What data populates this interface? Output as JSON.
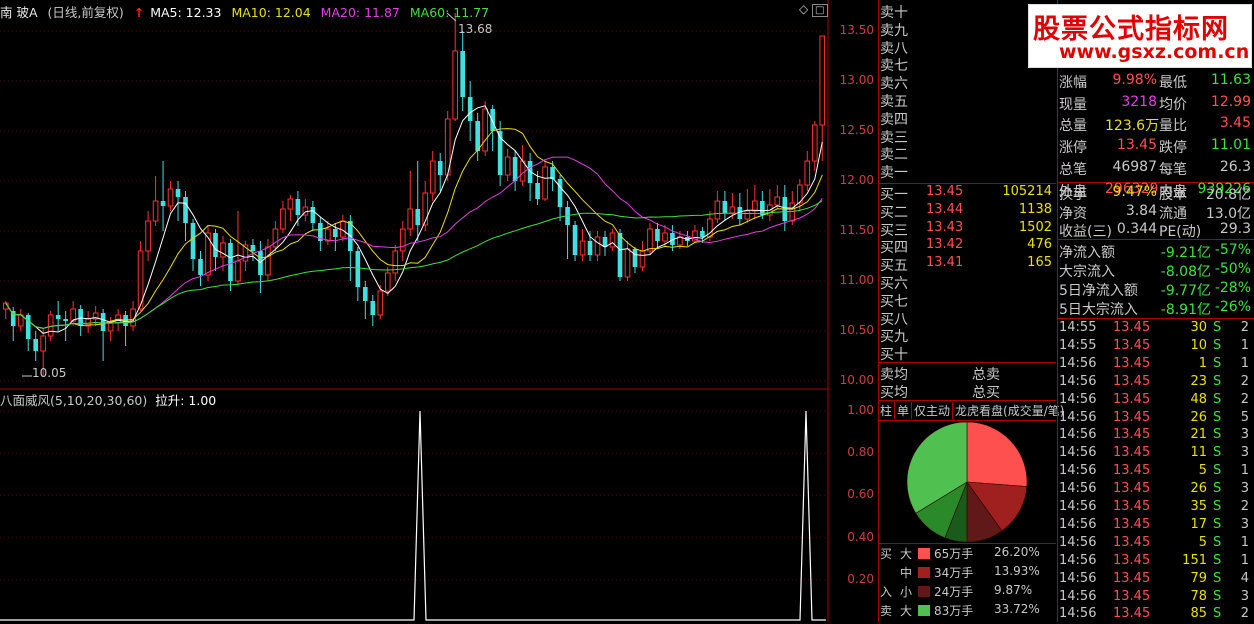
{
  "header": {
    "stock_name": "南 玻A",
    "period": "(日线,前复权)",
    "ma5": "MA5: 12.33",
    "ma10": "MA10: 12.04",
    "ma20": "MA20: 11.87",
    "ma60": "MA60: 11.77"
  },
  "colors": {
    "ma5": "#ffffff",
    "ma10": "#e8e000",
    "ma20": "#e040e0",
    "ma60": "#40e040",
    "up": "#ff3030",
    "down": "#40e0e0"
  },
  "main_axis": [
    "13.50",
    "13.00",
    "12.50",
    "12.00",
    "11.50",
    "11.00",
    "10.50",
    "10.00"
  ],
  "high_label": "13.68",
  "low_label": "10.05",
  "indicator": {
    "title": "八面威风(5,10,20,30,60)",
    "value": "拉升: 1.00",
    "axis": [
      "1.00",
      "0.80",
      "0.60",
      "0.40",
      "0.20"
    ]
  },
  "chart_data": {
    "type": "candlestick",
    "ylim": [
      9.95,
      13.75
    ],
    "candles": [
      [
        10.72,
        10.78,
        10.62,
        10.8
      ],
      [
        10.7,
        10.55,
        10.4,
        10.74
      ],
      [
        10.55,
        10.66,
        10.5,
        10.72
      ],
      [
        10.66,
        10.42,
        10.3,
        10.68
      ],
      [
        10.42,
        10.3,
        10.2,
        10.5
      ],
      [
        10.3,
        10.45,
        10.05,
        10.52
      ],
      [
        10.45,
        10.66,
        10.4,
        10.7
      ],
      [
        10.66,
        10.62,
        10.5,
        10.8
      ],
      [
        10.62,
        10.6,
        10.4,
        10.7
      ],
      [
        10.6,
        10.72,
        10.55,
        10.8
      ],
      [
        10.72,
        10.55,
        10.45,
        10.76
      ],
      [
        10.55,
        10.62,
        10.48,
        10.7
      ],
      [
        10.62,
        10.68,
        10.55,
        10.75
      ],
      [
        10.68,
        10.5,
        10.2,
        10.72
      ],
      [
        10.5,
        10.58,
        10.4,
        10.64
      ],
      [
        10.58,
        10.66,
        10.5,
        10.72
      ],
      [
        10.66,
        10.55,
        10.35,
        10.7
      ],
      [
        10.55,
        10.72,
        10.5,
        10.8
      ],
      [
        10.72,
        11.3,
        10.7,
        11.4
      ],
      [
        11.3,
        11.6,
        11.2,
        11.7
      ],
      [
        11.6,
        11.8,
        11.55,
        12.05
      ],
      [
        11.8,
        11.75,
        11.5,
        12.2
      ],
      [
        11.75,
        11.92,
        11.7,
        12.0
      ],
      [
        11.92,
        11.84,
        11.6,
        12.0
      ],
      [
        11.84,
        11.58,
        11.4,
        11.9
      ],
      [
        11.58,
        11.22,
        11.1,
        11.62
      ],
      [
        11.22,
        11.06,
        10.95,
        11.3
      ],
      [
        11.06,
        11.48,
        11.0,
        11.55
      ],
      [
        11.48,
        11.24,
        11.1,
        11.52
      ],
      [
        11.24,
        11.38,
        11.1,
        11.45
      ],
      [
        11.38,
        11.0,
        10.9,
        11.42
      ],
      [
        11.0,
        11.2,
        10.95,
        11.7
      ],
      [
        11.2,
        11.36,
        11.1,
        11.4
      ],
      [
        11.36,
        11.3,
        11.2,
        11.42
      ],
      [
        11.3,
        11.06,
        10.88,
        11.4
      ],
      [
        11.06,
        11.34,
        11.0,
        11.42
      ],
      [
        11.34,
        11.52,
        11.3,
        11.6
      ],
      [
        11.52,
        11.72,
        11.48,
        11.8
      ],
      [
        11.72,
        11.82,
        11.6,
        11.86
      ],
      [
        11.82,
        11.66,
        11.55,
        11.9
      ],
      [
        11.66,
        11.74,
        11.6,
        11.82
      ],
      [
        11.74,
        11.58,
        11.5,
        11.8
      ],
      [
        11.58,
        11.4,
        11.3,
        11.64
      ],
      [
        11.4,
        11.52,
        11.36,
        11.6
      ],
      [
        11.52,
        11.44,
        11.3,
        11.58
      ],
      [
        11.44,
        11.6,
        11.4,
        11.66
      ],
      [
        11.6,
        11.3,
        11.0,
        11.66
      ],
      [
        11.3,
        10.94,
        10.8,
        11.34
      ],
      [
        10.94,
        10.8,
        10.62,
        11.0
      ],
      [
        10.8,
        10.66,
        10.55,
        10.86
      ],
      [
        10.66,
        10.9,
        10.62,
        10.96
      ],
      [
        10.9,
        11.08,
        10.85,
        11.14
      ],
      [
        11.08,
        11.3,
        11.0,
        11.36
      ],
      [
        11.3,
        11.52,
        11.2,
        11.6
      ],
      [
        11.52,
        11.72,
        11.45,
        12.1
      ],
      [
        11.72,
        11.56,
        11.4,
        12.2
      ],
      [
        11.56,
        11.88,
        11.5,
        12.0
      ],
      [
        11.88,
        12.2,
        11.8,
        12.3
      ],
      [
        12.2,
        12.06,
        11.9,
        12.28
      ],
      [
        12.06,
        12.62,
        12.0,
        12.7
      ],
      [
        12.62,
        13.3,
        12.6,
        13.68
      ],
      [
        13.3,
        12.84,
        12.7,
        13.5
      ],
      [
        12.84,
        12.6,
        12.4,
        13.0
      ],
      [
        12.6,
        12.3,
        12.2,
        12.68
      ],
      [
        12.3,
        12.72,
        12.25,
        12.8
      ],
      [
        12.72,
        12.5,
        12.3,
        12.76
      ],
      [
        12.5,
        12.06,
        11.95,
        12.6
      ],
      [
        12.06,
        12.24,
        12.0,
        12.32
      ],
      [
        12.24,
        12.0,
        11.9,
        12.3
      ],
      [
        12.0,
        12.2,
        11.95,
        12.36
      ],
      [
        12.2,
        11.98,
        11.8,
        12.28
      ],
      [
        11.98,
        11.82,
        11.76,
        12.1
      ],
      [
        11.82,
        12.14,
        11.8,
        12.22
      ],
      [
        12.14,
        12.02,
        11.9,
        12.2
      ],
      [
        12.02,
        11.74,
        11.6,
        12.06
      ],
      [
        11.74,
        11.56,
        11.22,
        11.8
      ],
      [
        11.56,
        11.26,
        11.2,
        11.6
      ],
      [
        11.26,
        11.4,
        11.2,
        11.52
      ],
      [
        11.4,
        11.26,
        11.2,
        11.5
      ],
      [
        11.26,
        11.44,
        11.2,
        11.5
      ],
      [
        11.44,
        11.34,
        11.25,
        11.5
      ],
      [
        11.34,
        11.48,
        11.3,
        11.52
      ],
      [
        11.48,
        11.04,
        11.0,
        11.52
      ],
      [
        11.04,
        11.32,
        11.0,
        11.4
      ],
      [
        11.32,
        11.14,
        11.08,
        11.34
      ],
      [
        11.14,
        11.3,
        11.1,
        11.4
      ],
      [
        11.3,
        11.52,
        11.26,
        11.58
      ],
      [
        11.52,
        11.4,
        11.34,
        11.58
      ],
      [
        11.4,
        11.48,
        11.34,
        11.56
      ],
      [
        11.48,
        11.36,
        11.3,
        11.56
      ],
      [
        11.36,
        11.44,
        11.32,
        11.5
      ],
      [
        11.44,
        11.4,
        11.35,
        11.5
      ],
      [
        11.4,
        11.5,
        11.38,
        11.56
      ],
      [
        11.5,
        11.44,
        11.38,
        11.54
      ],
      [
        11.44,
        11.62,
        11.4,
        11.7
      ],
      [
        11.62,
        11.8,
        11.58,
        11.9
      ],
      [
        11.8,
        11.68,
        11.6,
        11.9
      ],
      [
        11.68,
        11.74,
        11.62,
        11.88
      ],
      [
        11.74,
        11.62,
        11.56,
        11.88
      ],
      [
        11.62,
        11.7,
        11.58,
        11.92
      ],
      [
        11.7,
        11.8,
        11.62,
        11.96
      ],
      [
        11.8,
        11.66,
        11.62,
        11.9
      ],
      [
        11.66,
        11.76,
        11.6,
        11.92
      ],
      [
        11.76,
        11.84,
        11.72,
        11.96
      ],
      [
        11.84,
        11.6,
        11.5,
        11.96
      ],
      [
        11.6,
        11.78,
        11.56,
        11.9
      ],
      [
        11.78,
        11.96,
        11.7,
        12.02
      ],
      [
        11.96,
        12.2,
        11.9,
        12.3
      ],
      [
        12.2,
        12.56,
        12.1,
        12.6
      ],
      [
        12.56,
        13.45,
        12.2,
        13.45
      ]
    ]
  },
  "book": {
    "sell_labels": [
      "卖十",
      "卖九",
      "卖八",
      "卖七",
      "卖六",
      "卖五",
      "卖四",
      "卖三",
      "卖二",
      "卖一"
    ],
    "buy": [
      {
        "label": "买一",
        "price": "13.45",
        "vol": "105214"
      },
      {
        "label": "买二",
        "price": "13.44",
        "vol": "1138"
      },
      {
        "label": "买三",
        "price": "13.43",
        "vol": "1502"
      },
      {
        "label": "买四",
        "price": "13.42",
        "vol": "476"
      },
      {
        "label": "买五",
        "price": "13.41",
        "vol": "165"
      },
      {
        "label": "买六",
        "price": "",
        "vol": ""
      },
      {
        "label": "买七",
        "price": "",
        "vol": ""
      },
      {
        "label": "买八",
        "price": "",
        "vol": ""
      },
      {
        "label": "买九",
        "price": "",
        "vol": ""
      },
      {
        "label": "买十",
        "price": "",
        "vol": ""
      }
    ],
    "sell_avg": "卖均",
    "buy_avg": "买均",
    "total_sell": "总卖",
    "total_buy": "总买",
    "tabs": [
      "柱",
      "单",
      "仅主动",
      "龙虎看盘(成交量/笔)"
    ],
    "pie": [
      {
        "name": "大买",
        "pct": 26.2,
        "color": "#ff5050"
      },
      {
        "name": "中买",
        "pct": 13.93,
        "color": "#a02020"
      },
      {
        "name": "小买",
        "pct": 9.87,
        "color": "#601818"
      },
      {
        "name": "小卖",
        "pct": 6.0,
        "color": "#1a5a1a"
      },
      {
        "name": "中卖",
        "pct": 10.28,
        "color": "#2a8a2a"
      },
      {
        "name": "大卖",
        "pct": 33.72,
        "color": "#50c050"
      }
    ],
    "legend": [
      {
        "side": "买",
        "size": "大",
        "vol": "65万手",
        "pct": "26.20%",
        "color": "#ff5050"
      },
      {
        "side": "",
        "size": "中",
        "vol": "34万手",
        "pct": "13.93%",
        "color": "#a02020"
      },
      {
        "side": "入",
        "size": "小",
        "vol": "24万手",
        "pct": "9.87%",
        "color": "#601818"
      },
      {
        "side": "卖",
        "size": "大",
        "vol": "83万手",
        "pct": "33.72%",
        "color": "#50c050"
      }
    ]
  },
  "watermark": {
    "line1": "股票公式指标网",
    "line2": "www.gsxz.com.cn"
  },
  "quote": {
    "rows": [
      {
        "k1": "涨跌",
        "v1": "",
        "c1": "#ff5050",
        "k2": "最高",
        "v2": "",
        "c2": "#ff5050"
      },
      {
        "k1": "涨幅",
        "v1": "9.98%",
        "c1": "#ff5050",
        "k2": "最低",
        "v2": "11.63",
        "c2": "#40e040"
      },
      {
        "k1": "现量",
        "v1": "3218",
        "c1": "#e040e0",
        "k2": "均价",
        "v2": "12.99",
        "c2": "#ff5050"
      },
      {
        "k1": "总量",
        "v1": "123.6万",
        "c1": "#e8e000",
        "k2": "量比",
        "v2": "3.45",
        "c2": "#ff5050"
      },
      {
        "k1": "涨停",
        "v1": "13.45",
        "c1": "#ff5050",
        "k2": "跌停",
        "v2": "11.01",
        "c2": "#40e040"
      },
      {
        "k1": "总笔",
        "v1": "46987",
        "c1": "#c8c8c8",
        "k2": "每笔",
        "v2": "26.3",
        "c2": "#c8c8c8"
      },
      {
        "k1": "外盘",
        "v1": "296329",
        "c1": "#ff5050",
        "k2": "内盘",
        "v2": "939226",
        "c2": "#40e040"
      }
    ],
    "rows2": [
      {
        "k1": "换手",
        "v1": "9.47%",
        "c1": "#e8e000",
        "k2": "股本",
        "v2": "20.8亿",
        "c2": "#c8c8c8"
      },
      {
        "k1": "净资",
        "v1": "3.84",
        "c1": "#c8c8c8",
        "k2": "流通",
        "v2": "13.0亿",
        "c2": "#c8c8c8"
      },
      {
        "k1": "收益(三)",
        "v1": "0.344",
        "c1": "#c8c8c8",
        "k2": "PE(动)",
        "v2": "29.3",
        "c2": "#c8c8c8"
      }
    ],
    "flows": [
      {
        "k": "净流入额",
        "v": "-9.21亿",
        "p": "-57%"
      },
      {
        "k": "大宗流入",
        "v": "-8.08亿",
        "p": "-50%"
      },
      {
        "k": "5日净流入额",
        "v": "-9.77亿",
        "p": "-28%"
      },
      {
        "k": "5日大宗流入",
        "v": "-8.91亿",
        "p": "-26%"
      }
    ],
    "ticks": [
      {
        "t": "14:55",
        "p": "13.45",
        "v": "30",
        "s": "S",
        "n": "2"
      },
      {
        "t": "14:55",
        "p": "13.45",
        "v": "10",
        "s": "S",
        "n": "1"
      },
      {
        "t": "14:56",
        "p": "13.45",
        "v": "1",
        "s": "S",
        "n": "1"
      },
      {
        "t": "14:56",
        "p": "13.45",
        "v": "23",
        "s": "S",
        "n": "2"
      },
      {
        "t": "14:56",
        "p": "13.45",
        "v": "48",
        "s": "S",
        "n": "2"
      },
      {
        "t": "14:56",
        "p": "13.45",
        "v": "26",
        "s": "S",
        "n": "5"
      },
      {
        "t": "14:56",
        "p": "13.45",
        "v": "21",
        "s": "S",
        "n": "3"
      },
      {
        "t": "14:56",
        "p": "13.45",
        "v": "11",
        "s": "S",
        "n": "3"
      },
      {
        "t": "14:56",
        "p": "13.45",
        "v": "5",
        "s": "S",
        "n": "1"
      },
      {
        "t": "14:56",
        "p": "13.45",
        "v": "26",
        "s": "S",
        "n": "3"
      },
      {
        "t": "14:56",
        "p": "13.45",
        "v": "35",
        "s": "S",
        "n": "2"
      },
      {
        "t": "14:56",
        "p": "13.45",
        "v": "17",
        "s": "S",
        "n": "3"
      },
      {
        "t": "14:56",
        "p": "13.45",
        "v": "5",
        "s": "S",
        "n": "1"
      },
      {
        "t": "14:56",
        "p": "13.45",
        "v": "151",
        "s": "S",
        "n": "1"
      },
      {
        "t": "14:56",
        "p": "13.45",
        "v": "79",
        "s": "S",
        "n": "4"
      },
      {
        "t": "14:56",
        "p": "13.45",
        "v": "78",
        "s": "S",
        "n": "3"
      },
      {
        "t": "14:56",
        "p": "13.45",
        "v": "85",
        "s": "S",
        "n": "2"
      }
    ]
  }
}
